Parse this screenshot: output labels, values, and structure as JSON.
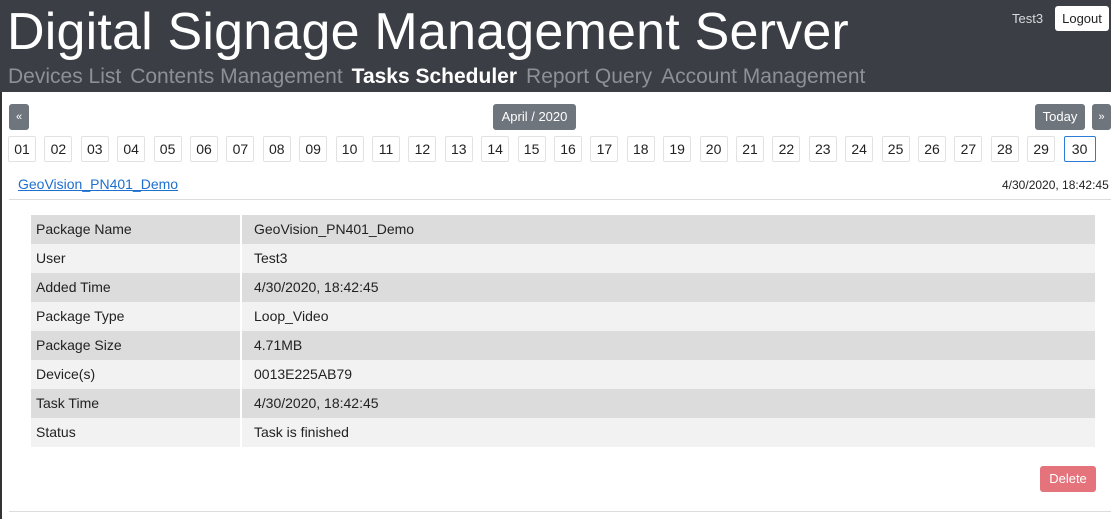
{
  "app": {
    "title": "Digital Signage Management Server",
    "user": "Test3",
    "logout_label": "Logout"
  },
  "nav": {
    "items": [
      {
        "label": "Devices List",
        "active": false
      },
      {
        "label": "Contents Management",
        "active": false
      },
      {
        "label": "Tasks Scheduler",
        "active": true
      },
      {
        "label": "Report Query",
        "active": false
      },
      {
        "label": "Account Management",
        "active": false
      }
    ]
  },
  "calendar": {
    "prev_label": "«",
    "next_label": "»",
    "month_label": "April / 2020",
    "today_label": "Today",
    "days": [
      "01",
      "02",
      "03",
      "04",
      "05",
      "06",
      "07",
      "08",
      "09",
      "10",
      "11",
      "12",
      "13",
      "14",
      "15",
      "16",
      "17",
      "18",
      "19",
      "20",
      "21",
      "22",
      "23",
      "24",
      "25",
      "26",
      "27",
      "28",
      "29",
      "30"
    ],
    "selected_day": "30"
  },
  "task": {
    "name": "GeoVision_PN401_Demo",
    "timestamp": "4/30/2020, 18:42:45",
    "details": [
      {
        "label": "Package Name",
        "value": "GeoVision_PN401_Demo"
      },
      {
        "label": "User",
        "value": "Test3"
      },
      {
        "label": "Added Time",
        "value": "4/30/2020, 18:42:45"
      },
      {
        "label": "Package Type",
        "value": "Loop_Video"
      },
      {
        "label": "Package Size",
        "value": "4.71MB"
      },
      {
        "label": "Device(s)",
        "value": "0013E225AB79"
      },
      {
        "label": "Task Time",
        "value": "4/30/2020, 18:42:45"
      },
      {
        "label": "Status",
        "value": "Task is finished"
      }
    ],
    "delete_label": "Delete"
  },
  "colors": {
    "header_bg": "#3b3f45",
    "nav_inactive": "#8c9097",
    "link": "#1f6fcf",
    "button_gray": "#6f757d",
    "delete": "#e4737c",
    "selected_day_border": "#2e7bd6"
  }
}
